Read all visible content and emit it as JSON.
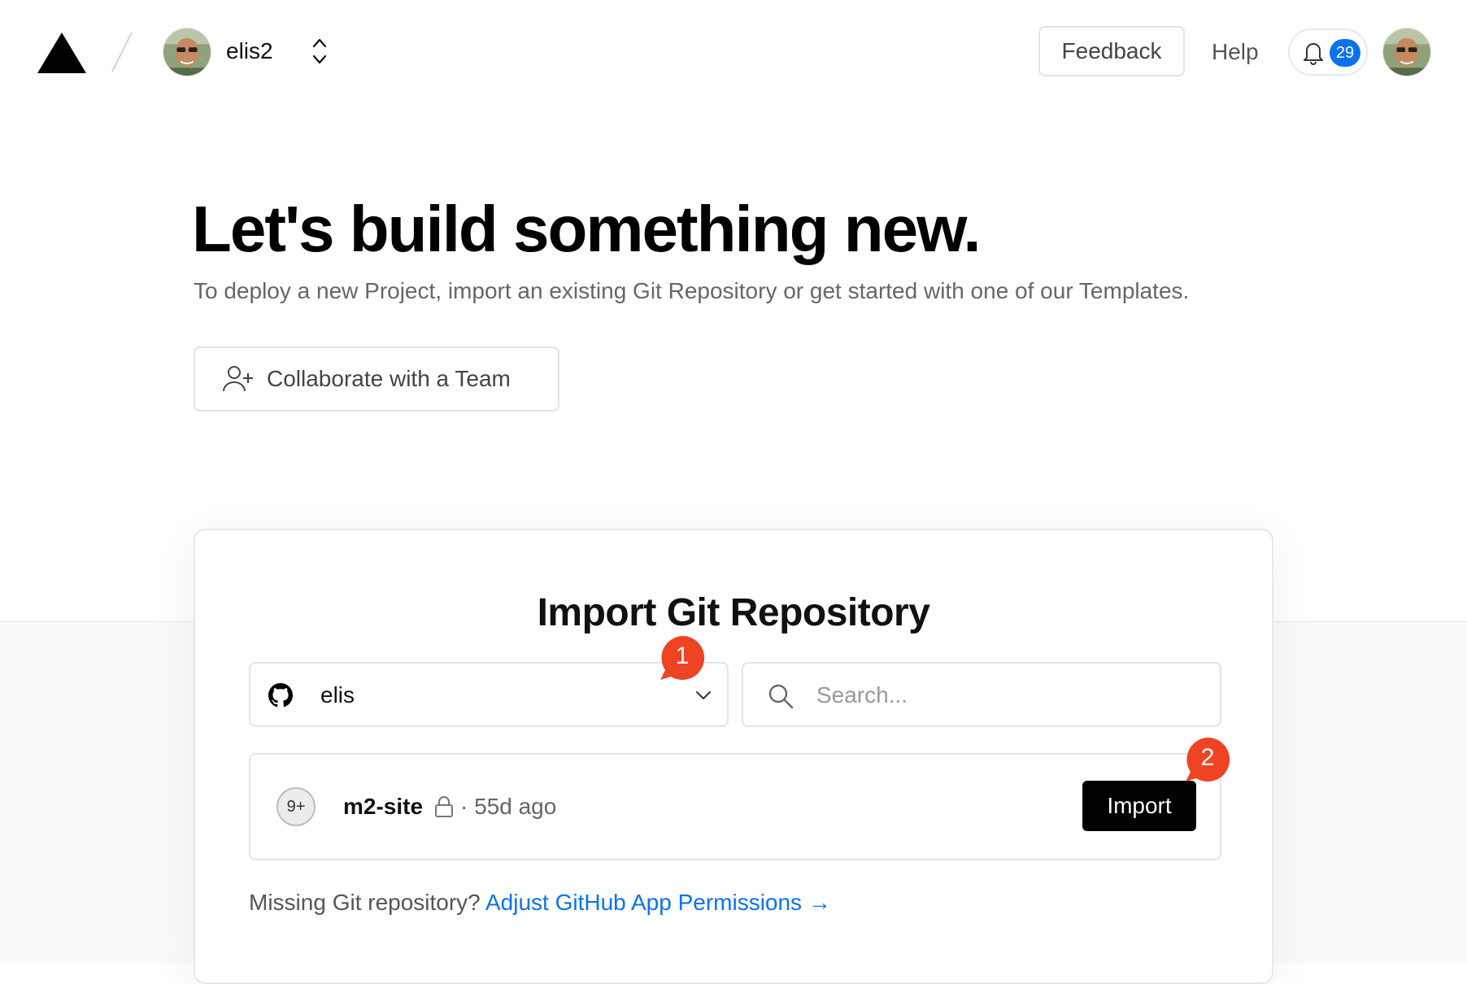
{
  "header": {
    "account_name": "elis2",
    "feedback_label": "Feedback",
    "help_label": "Help",
    "notification_count": "29"
  },
  "hero": {
    "title": "Let's build something new.",
    "subtitle": "To deploy a new Project, import an existing Git Repository or get started with one of our Templates.",
    "collab_label": "Collaborate with a Team"
  },
  "import": {
    "title": "Import Git Repository",
    "org_value": "elis",
    "search_placeholder": "Search...",
    "repos": [
      {
        "badge": "9+",
        "name": "m2-site",
        "meta": "· 55d ago",
        "action": "Import"
      }
    ],
    "missing_text": "Missing Git repository?",
    "missing_link": "Adjust GitHub App Permissions →"
  },
  "markers": [
    "1",
    "2"
  ],
  "colors": {
    "accent": "#0a72ef",
    "marker": "#ee4423",
    "primary_button": "#000000"
  }
}
